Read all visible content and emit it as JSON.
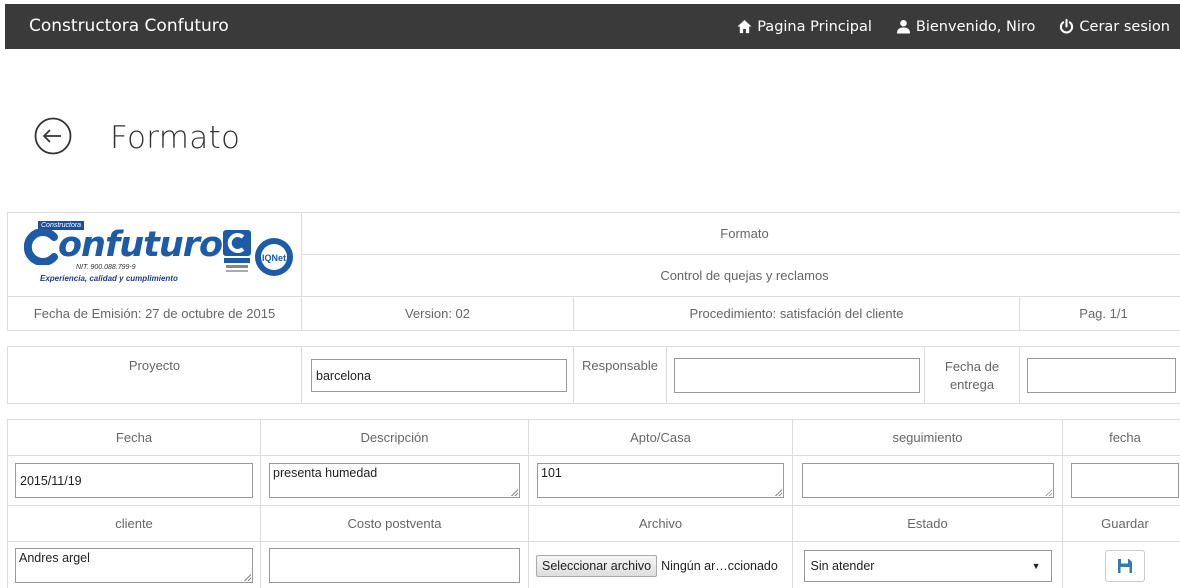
{
  "navbar": {
    "brand": "Constructora Confuturo",
    "links": [
      {
        "label": "Pagina Principal",
        "icon": "home-icon"
      },
      {
        "label": "Bienvenido, Niro",
        "icon": "user-icon"
      },
      {
        "label": "Cerar sesion",
        "icon": "power-icon"
      }
    ]
  },
  "page": {
    "title": "Formato",
    "back_icon": "arrow-left-circle-icon"
  },
  "logo": {
    "badge": "Constructora",
    "word": "onfuturo",
    "initial": "C",
    "nit": "NIT. 900.088.799-9",
    "slogan": "Experiencia, calidad y cumplimiento",
    "cert_label": "IQNet"
  },
  "header": {
    "title": "Formato",
    "subtitle": "Control de quejas y reclamos",
    "emission_date": "Fecha de Emisión: 27 de octubre de 2015",
    "version": "Version: 02",
    "procedure": "Procedimiento: satisfación del cliente",
    "page": "Pag. 1/1"
  },
  "project": {
    "proyecto_label": "Proyecto",
    "proyecto_value": "barcelona",
    "responsable_label": "Responsable",
    "responsable_value": "",
    "fecha_entrega_label": "Fecha de entrega",
    "fecha_entrega_value": ""
  },
  "form": {
    "row1_labels": [
      "Fecha",
      "Descripción",
      "Apto/Casa",
      "seguimiento",
      "fecha"
    ],
    "fecha_value": "2015/11/19",
    "descripcion_value": "presenta humedad",
    "apto_value": "101",
    "seguimiento_value": "",
    "fecha2_value": "",
    "row2_labels": [
      "cliente",
      "Costo postventa",
      "Archivo",
      "Estado",
      "Guardar"
    ],
    "cliente_value": "Andres argel",
    "costo_value": "",
    "file_button": "Seleccionar archivo",
    "file_status": "Ningún ar…ccionado",
    "estado_value": "Sin atender",
    "save_icon": "floppy-disk-icon"
  },
  "colors": {
    "navbar_bg": "#3a3a3a",
    "accent": "#337ab7",
    "logo_blue": "#1d5aa8"
  }
}
